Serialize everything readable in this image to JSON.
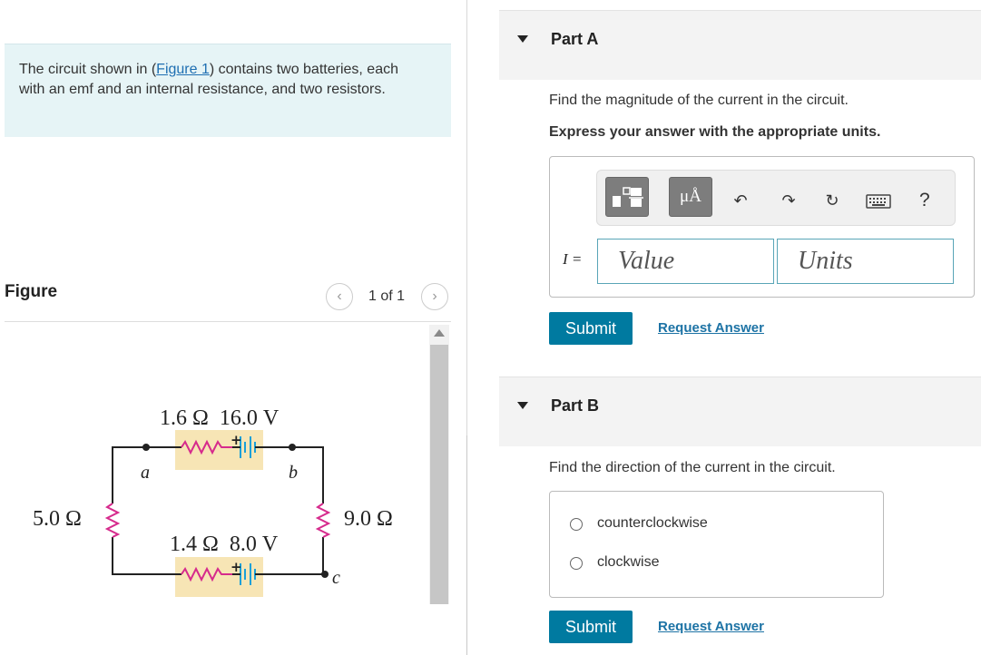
{
  "problem": {
    "text_before": "The circuit shown in (",
    "link": "Figure 1",
    "text_after": ") contains two batteries, each with an emf and an internal resistance, and two resistors."
  },
  "figure": {
    "heading": "Figure",
    "pager_text": "1 of 1",
    "labels": {
      "top_battery": "1.6 Ω  16.0 V",
      "bottom_battery": "1.4 Ω  8.0 V",
      "left_resistor": "5.0 Ω",
      "right_resistor": "9.0 Ω",
      "node_a": "a",
      "node_b": "b",
      "node_c": "c",
      "plus_top": "+",
      "plus_bottom": "+"
    }
  },
  "partA": {
    "title": "Part A",
    "question": "Find the magnitude of the current in the circuit.",
    "instruction": "Express your answer with the appropriate units.",
    "variable": "I =",
    "value_placeholder": "Value",
    "units_placeholder": "Units",
    "unit_btn": "μÅ",
    "help": "?",
    "submit": "Submit",
    "request": "Request Answer"
  },
  "partB": {
    "title": "Part B",
    "question": "Find the direction of the current in the circuit.",
    "options": [
      "counterclockwise",
      "clockwise"
    ],
    "submit": "Submit",
    "request": "Request Answer"
  },
  "colors": {
    "accent": "#007aa0",
    "link": "#1d73a5",
    "panel": "#e6f4f6"
  }
}
